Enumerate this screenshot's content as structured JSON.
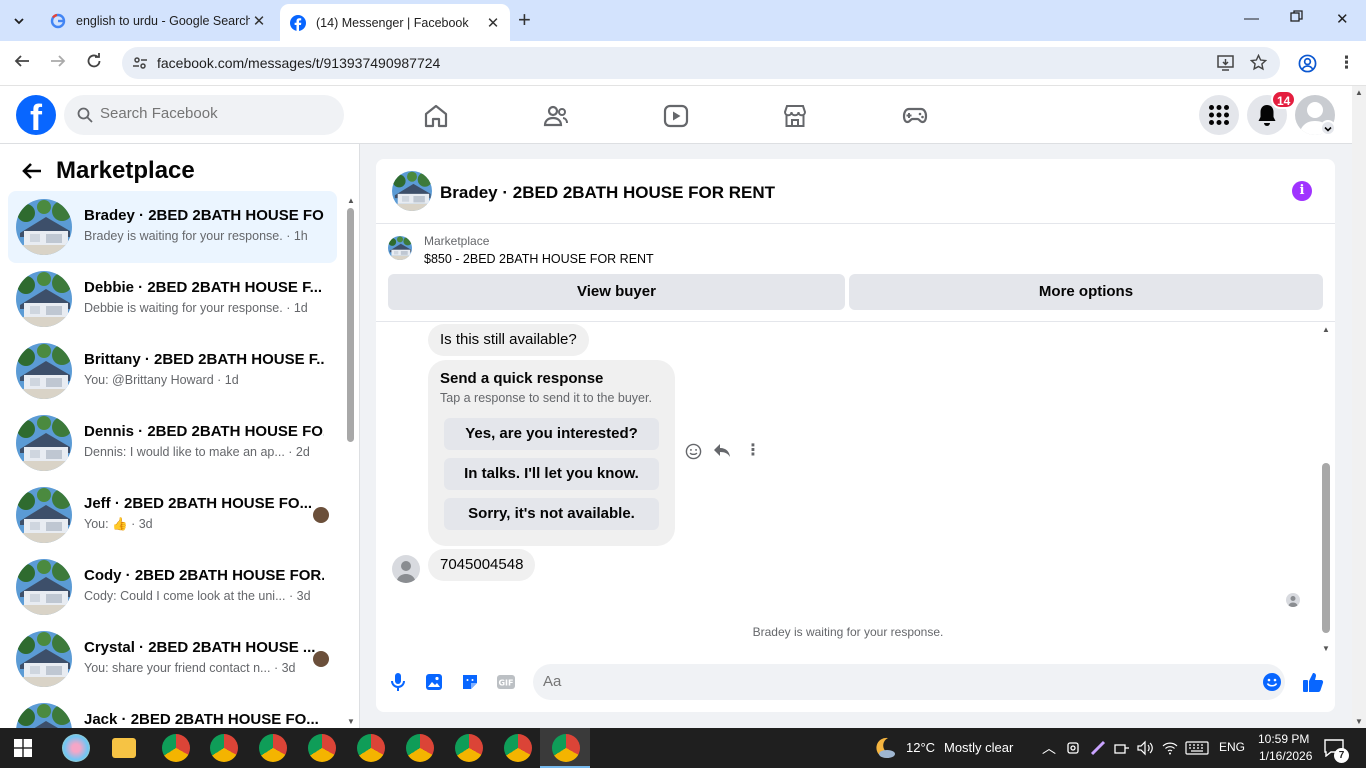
{
  "browser": {
    "tabs": [
      {
        "title": "english to urdu - Google Search",
        "favicon": "google-icon"
      },
      {
        "title": "(14) Messenger | Facebook",
        "favicon": "facebook-icon"
      }
    ],
    "url": "facebook.com/messages/t/913937490987724"
  },
  "header": {
    "search_placeholder": "Search Facebook",
    "notification_count": "14",
    "brand_color": "#0866ff"
  },
  "sidebar": {
    "title": "Marketplace",
    "conversations": [
      {
        "name": "Bradey · 2BED 2BATH HOUSE FO...",
        "preview": "Bradey is waiting for your response.",
        "time": "· 1h"
      },
      {
        "name": "Debbie · 2BED 2BATH HOUSE F...",
        "preview": "Debbie is waiting for your response.",
        "time": "· 1d"
      },
      {
        "name": "Brittany · 2BED 2BATH HOUSE F...",
        "preview": "You: @Brittany Howard",
        "time": "· 1d"
      },
      {
        "name": "Dennis · 2BED 2BATH HOUSE FO...",
        "preview": "Dennis: I would like to make an ap...",
        "time": "· 2d"
      },
      {
        "name": "Jeff · 2BED 2BATH HOUSE FO...",
        "preview": "You: 👍",
        "time": "· 3d"
      },
      {
        "name": "Cody · 2BED 2BATH HOUSE FOR...",
        "preview": "Cody: Could I come look at the uni...",
        "time": "· 3d"
      },
      {
        "name": "Crystal · 2BED 2BATH HOUSE ...",
        "preview": "You: share your friend contact n...",
        "time": "· 3d"
      },
      {
        "name": "Jack · 2BED 2BATH HOUSE FO...",
        "preview": "",
        "time": ""
      }
    ]
  },
  "chat": {
    "title": "Bradey · 2BED 2BATH HOUSE FOR RENT",
    "marketplace_label": "Marketplace",
    "listing": "$850 - 2BED 2BATH HOUSE FOR RENT",
    "view_buyer": "View buyer",
    "more_options": "More options",
    "message_1": "Is this still available?",
    "quick_title": "Send a quick response",
    "quick_subtitle": "Tap a response to send it to the buyer.",
    "quick_options": [
      "Yes, are you interested?",
      "In talks. I'll let you know.",
      "Sorry, it's not available."
    ],
    "message_2": "7045004548",
    "waiting": "Bradey is waiting for your response.",
    "composer_placeholder": "Aa"
  },
  "taskbar": {
    "temperature": "12°C",
    "weather": "Mostly clear",
    "language": "ENG",
    "time": "10:59 PM",
    "date": "1/16/2026",
    "notif_count": "7"
  }
}
